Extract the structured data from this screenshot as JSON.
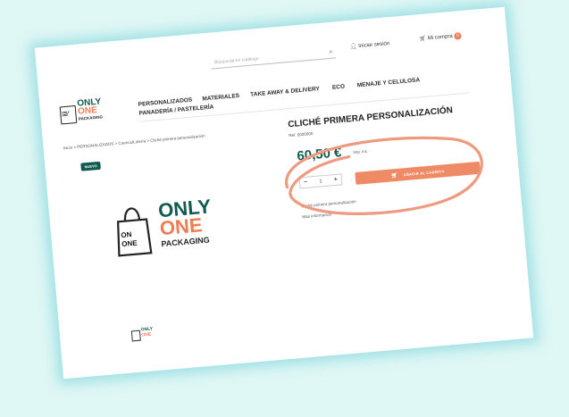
{
  "header": {
    "search_placeholder": "Búsqueda en catálogo",
    "login_label": "Iniciar sesión",
    "cart_label": "Mi compra",
    "cart_count": "0"
  },
  "logo": {
    "line1": "ONLY",
    "line2": "ONE",
    "line3": "PACKAGING",
    "bag_text": "ONLY ONE"
  },
  "nav": {
    "items": [
      "PERSONALIZADOS",
      "MATERIALES",
      "TAKE AWAY & DELIVERY",
      "ECO",
      "MENAJE Y CELULOSA",
      "PANADERÍA / PASTELERÍA"
    ]
  },
  "breadcrumb": "Inicio > PERSONALIZADOS > Cuenca/Lotería > Cliché primera personalización",
  "badge": "NUEVO",
  "product": {
    "title": "CLICHÉ PRIMERA PERSONALIZACIÓN",
    "ref": "Ref. 0000000",
    "price": "60,50 €",
    "tax": "Imp. inc.",
    "quantity": "1",
    "minus": "−",
    "plus": "+",
    "add_to_cart": "AÑADIR AL CARRITO",
    "desc": "Cliché primera personalización",
    "more_info": "Más información"
  },
  "colors": {
    "accent": "#ee7d55",
    "brand_green": "#0f5b50",
    "annotation": "#ee9a80"
  }
}
